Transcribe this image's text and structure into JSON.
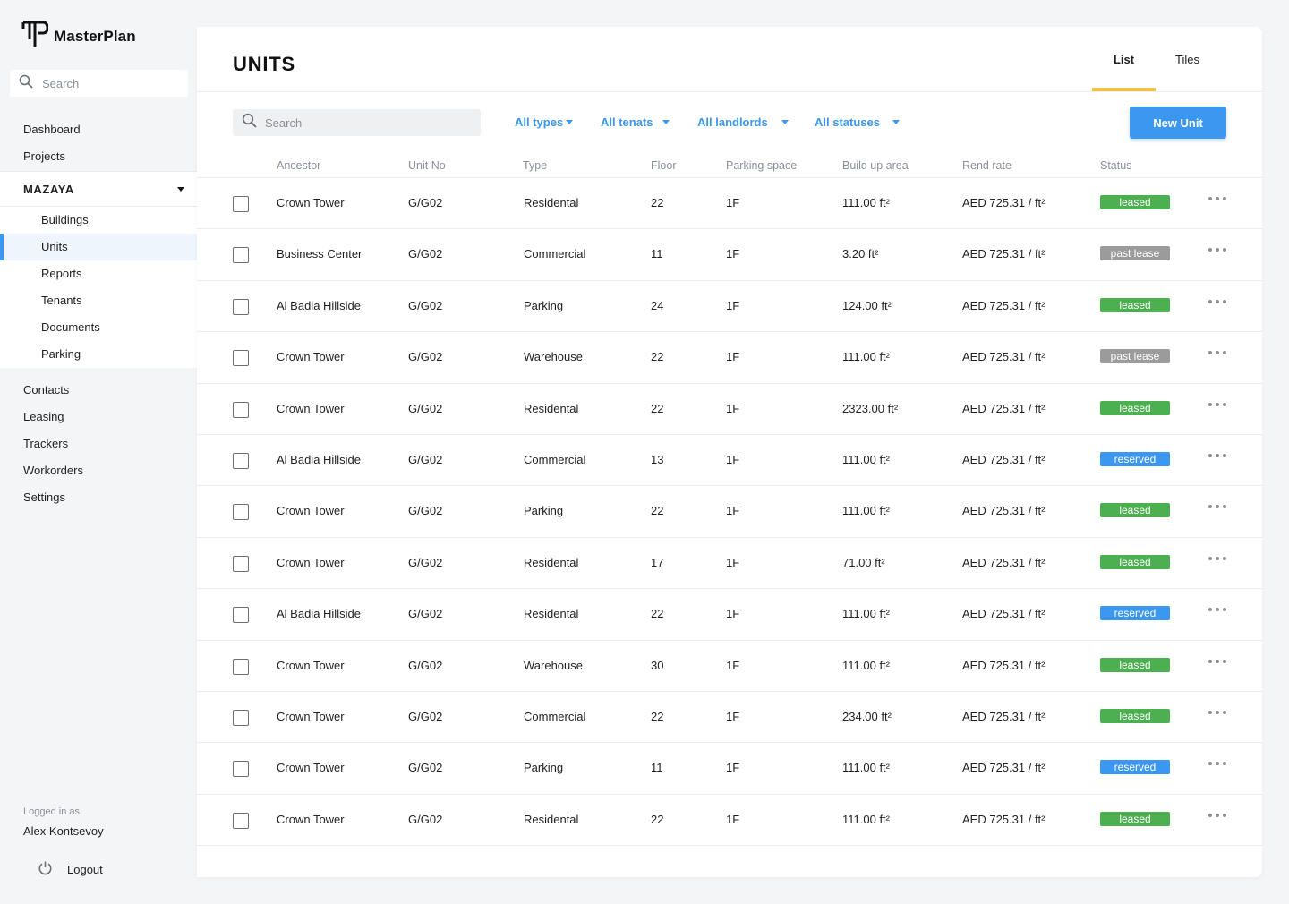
{
  "app": {
    "name": "MasterPlan"
  },
  "sidebar": {
    "search_placeholder": "Search",
    "top_items": [
      {
        "label": "Dashboard"
      },
      {
        "label": "Projects"
      }
    ],
    "group": {
      "label": "MAZAYA",
      "items": [
        {
          "label": "Buildings",
          "active": false
        },
        {
          "label": "Units",
          "active": true
        },
        {
          "label": "Reports",
          "active": false
        },
        {
          "label": "Tenants",
          "active": false
        },
        {
          "label": "Documents",
          "active": false
        },
        {
          "label": "Parking",
          "active": false
        }
      ]
    },
    "bottom_items": [
      {
        "label": "Contacts"
      },
      {
        "label": "Leasing"
      },
      {
        "label": "Trackers"
      },
      {
        "label": "Workorders"
      },
      {
        "label": "Settings"
      }
    ],
    "logged_in_label": "Logged in as",
    "user_name": "Alex Kontsevoy",
    "logout_label": "Logout"
  },
  "main": {
    "title": "UNITS",
    "view_tabs": [
      {
        "label": "List",
        "active": true
      },
      {
        "label": "Tiles",
        "active": false
      }
    ],
    "search_placeholder": "Search",
    "filters": [
      {
        "label": "All types"
      },
      {
        "label": "All tenats"
      },
      {
        "label": "All landlords"
      },
      {
        "label": "All statuses"
      }
    ],
    "new_button_label": "New Unit",
    "columns": [
      "Ancestor",
      "Unit No",
      "Type",
      "Floor",
      "Parking space",
      "Build up area",
      "Rend rate",
      "Status"
    ],
    "rows": [
      {
        "ancestor": "Crown Tower",
        "unit_no": "G/G02",
        "type": "Residental",
        "floor": "22",
        "parking": "1F",
        "area": "111.00 ft²",
        "rate": "AED 725.31 / ft²",
        "status": "leased"
      },
      {
        "ancestor": "Business Center",
        "unit_no": "G/G02",
        "type": "Commercial",
        "floor": "11",
        "parking": "1F",
        "area": "3.20 ft²",
        "rate": "AED 725.31 / ft²",
        "status": "past lease"
      },
      {
        "ancestor": "Al Badia Hillside",
        "unit_no": "G/G02",
        "type": "Parking",
        "floor": "24",
        "parking": "1F",
        "area": "124.00 ft²",
        "rate": "AED 725.31 / ft²",
        "status": "leased"
      },
      {
        "ancestor": "Crown Tower",
        "unit_no": "G/G02",
        "type": "Warehouse",
        "floor": "22",
        "parking": "1F",
        "area": "111.00 ft²",
        "rate": "AED 725.31 / ft²",
        "status": "past lease"
      },
      {
        "ancestor": "Crown Tower",
        "unit_no": "G/G02",
        "type": "Residental",
        "floor": "22",
        "parking": "1F",
        "area": "2323.00 ft²",
        "rate": "AED 725.31 / ft²",
        "status": "leased"
      },
      {
        "ancestor": "Al Badia Hillside",
        "unit_no": "G/G02",
        "type": "Commercial",
        "floor": "13",
        "parking": "1F",
        "area": "111.00 ft²",
        "rate": "AED 725.31 / ft²",
        "status": "reserved"
      },
      {
        "ancestor": "Crown Tower",
        "unit_no": "G/G02",
        "type": "Parking",
        "floor": "22",
        "parking": "1F",
        "area": "111.00 ft²",
        "rate": "AED 725.31 / ft²",
        "status": "leased"
      },
      {
        "ancestor": "Crown Tower",
        "unit_no": "G/G02",
        "type": "Residental",
        "floor": "17",
        "parking": "1F",
        "area": "71.00 ft²",
        "rate": "AED 725.31 / ft²",
        "status": "leased"
      },
      {
        "ancestor": "Al Badia Hillside",
        "unit_no": "G/G02",
        "type": "Residental",
        "floor": "22",
        "parking": "1F",
        "area": "111.00 ft²",
        "rate": "AED 725.31 / ft²",
        "status": "reserved"
      },
      {
        "ancestor": "Crown Tower",
        "unit_no": "G/G02",
        "type": "Warehouse",
        "floor": "30",
        "parking": "1F",
        "area": "111.00 ft²",
        "rate": "AED 725.31 / ft²",
        "status": "leased"
      },
      {
        "ancestor": "Crown Tower",
        "unit_no": "G/G02",
        "type": "Commercial",
        "floor": "22",
        "parking": "1F",
        "area": "234.00 ft²",
        "rate": "AED 725.31 / ft²",
        "status": "leased"
      },
      {
        "ancestor": "Crown Tower",
        "unit_no": "G/G02",
        "type": "Parking",
        "floor": "11",
        "parking": "1F",
        "area": "111.00 ft²",
        "rate": "AED 725.31 / ft²",
        "status": "reserved"
      },
      {
        "ancestor": "Crown Tower",
        "unit_no": "G/G02",
        "type": "Residental",
        "floor": "22",
        "parking": "1F",
        "area": "111.00 ft²",
        "rate": "AED 725.31 / ft²",
        "status": "leased"
      }
    ]
  },
  "colors": {
    "accent": "#3b97f0",
    "tab_underline": "#f5c242",
    "status_leased": "#4caf50",
    "status_past_lease": "#9b9b9b",
    "status_reserved": "#3b97f0"
  },
  "icons": {
    "logo": "masterplan-logo-icon",
    "search": "search-icon",
    "caret": "caret-down-icon",
    "more": "more-dots-icon",
    "power": "power-icon"
  }
}
